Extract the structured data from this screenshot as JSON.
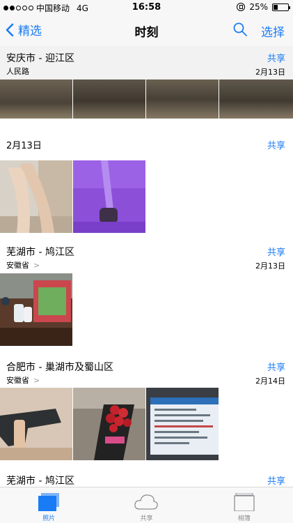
{
  "status": {
    "carrier": "中国移动",
    "network": "4G",
    "time": "16:58",
    "battery": "25%"
  },
  "nav": {
    "back_label": "精选",
    "title": "时刻",
    "select_label": "选择"
  },
  "sections": [
    {
      "location": "安庆市 - 迎江区",
      "sublocation": "人民路",
      "date": "2月13日",
      "share": "共享"
    },
    {
      "date_header": "2月13日",
      "share": "共享"
    },
    {
      "location": "芜湖市 - 鸠江区",
      "sublocation": "安徽省",
      "date": "2月13日",
      "share": "共享"
    },
    {
      "location": "合肥市 - 巢湖市及蜀山区",
      "sublocation": "安徽省",
      "date": "2月14日",
      "share": "共享"
    },
    {
      "location": "芜湖市 - 鸠江区",
      "share": "共享"
    }
  ],
  "tabs": [
    {
      "label": "照片",
      "icon": "photos-icon",
      "active": true
    },
    {
      "label": "共享",
      "icon": "cloud-icon",
      "active": false
    },
    {
      "label": "相簿",
      "icon": "albums-icon",
      "active": false
    }
  ],
  "colors": {
    "accent": "#1a7cf5",
    "bar_bg": "#f7f7f7"
  }
}
